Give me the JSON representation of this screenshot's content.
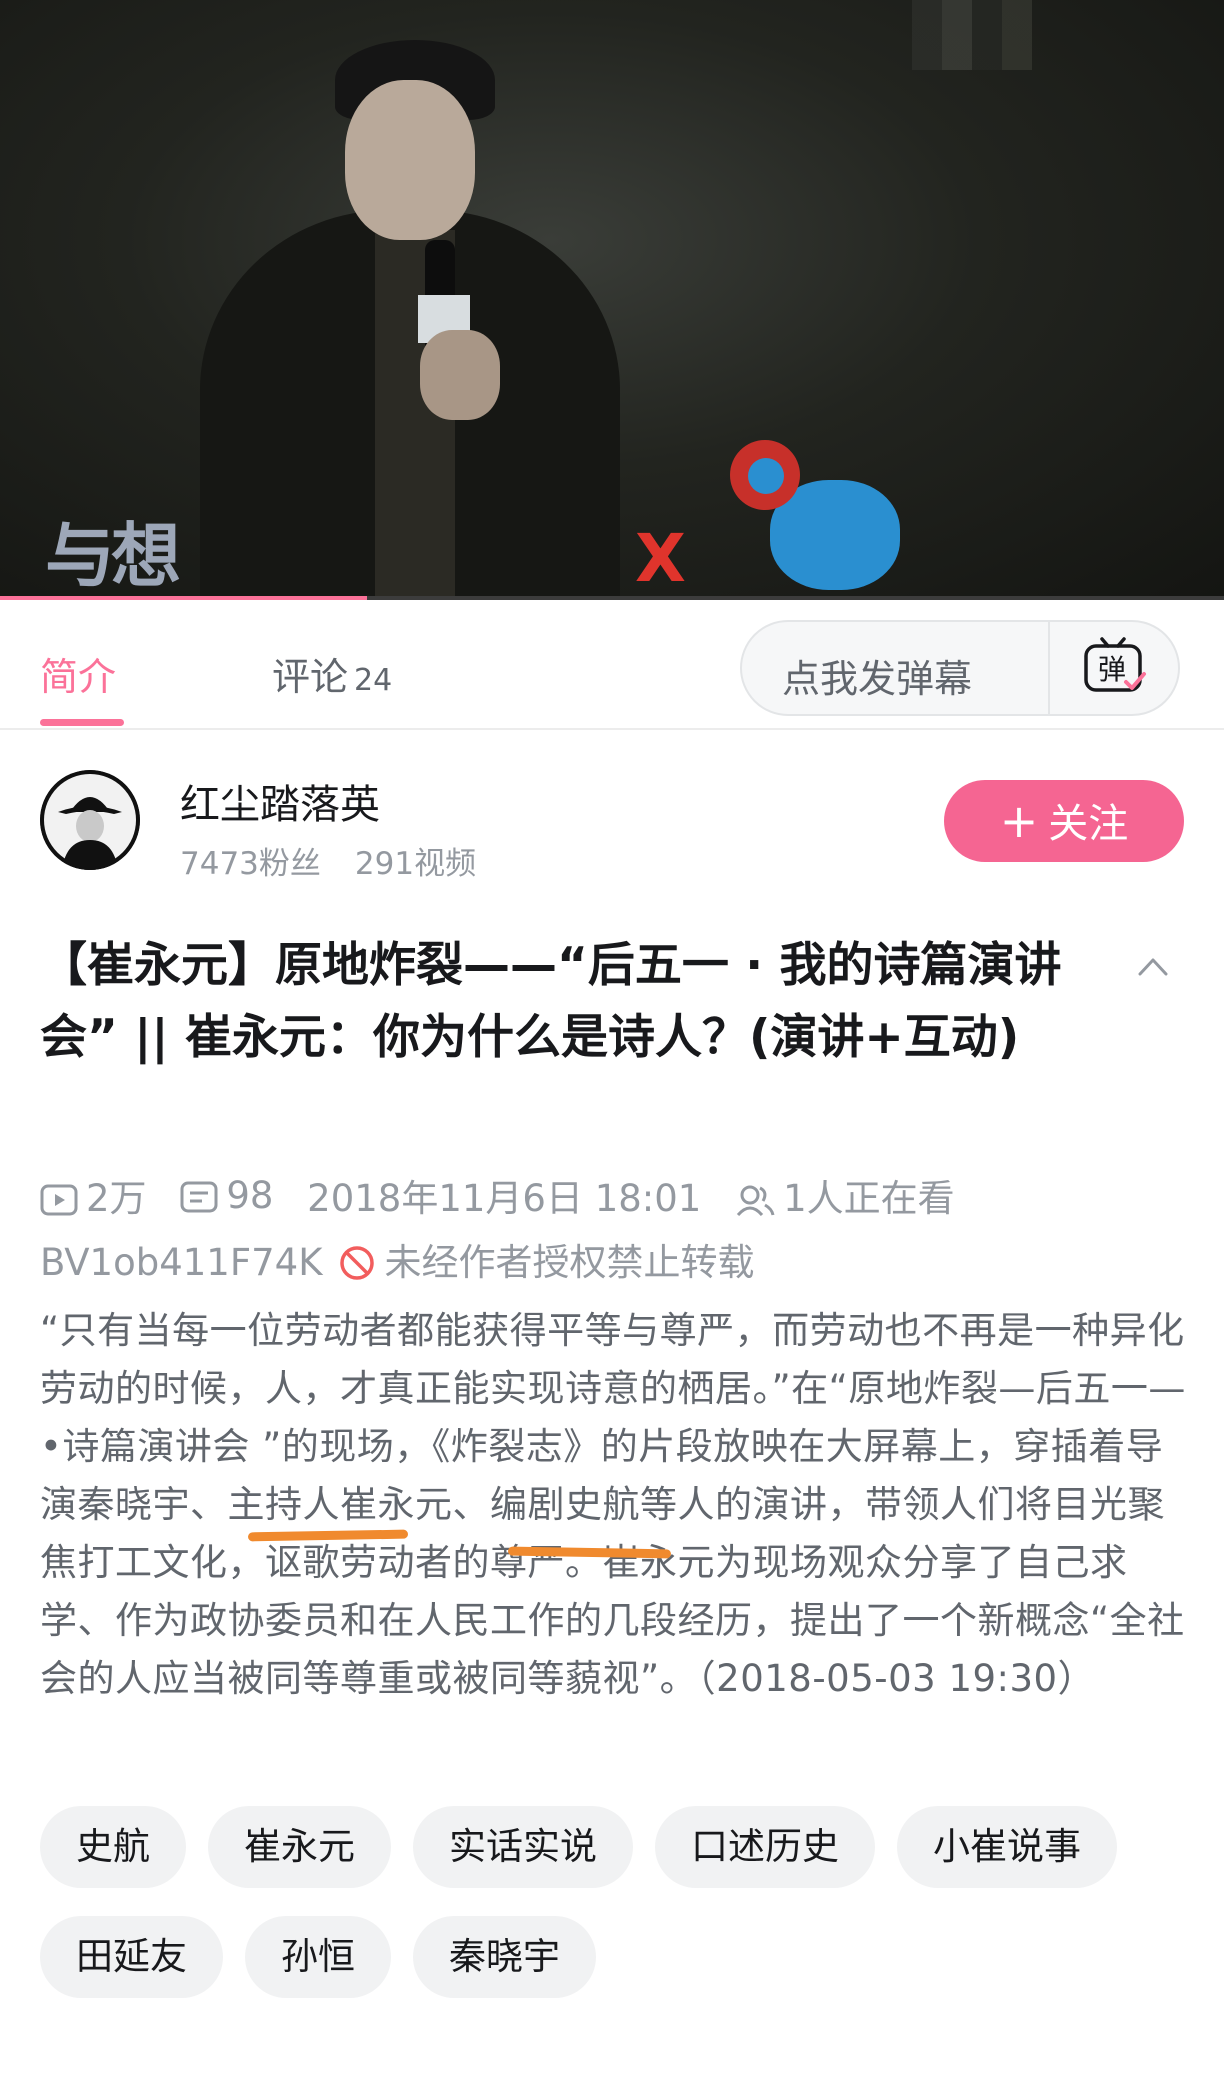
{
  "video": {
    "stage_text": "与想",
    "stage_x": "X",
    "progress": 0.3
  },
  "tabs": {
    "intro_label": "简介",
    "comments_label": "评论",
    "comments_count": "24",
    "danmaku_placeholder": "点我发弹幕",
    "danmaku_icon_text": "弹"
  },
  "uploader": {
    "name": "红尘踏落英",
    "fans": "7473粉丝",
    "videos": "291视频",
    "follow_label": "关注"
  },
  "video_info": {
    "title": "【崔永元】原地炸裂——“后五一 · 我的诗篇演讲会” || 崔永元：你为什么是诗人？(演讲+互动)",
    "views": "2万",
    "danmaku_count": "98",
    "publish_time": "2018年11月6日 18:01",
    "watching": "1人正在看",
    "bvid": "BV1ob411F74K",
    "copyright_notice": "未经作者授权禁止转载",
    "description": "“只有当每一位劳动者都能获得平等与尊严，而劳动也不再是一种异化劳动的时候，人，才真正能实现诗意的栖居。”在“原地炸裂—后五一—•诗篇演讲会 ”的现场，《炸裂志》的片段放映在大屏幕上，穿插着导演秦晓宇、主持人崔永元、编剧史航等人的演讲，带领人们将目光聚焦打工文化，讴歌劳动者的尊严。崔永元为现场观众分享了自己求学、作为政协委员和在人民工作的几段经历，提出了一个新概念“全社会的人应当被同等尊重或被同等藐视”。（2018-05-03 19:30）"
  },
  "tags": [
    "史航",
    "崔永元",
    "实话实说",
    "口述历史",
    "小崔说事",
    "田延友",
    "孙恒",
    "秦晓宇"
  ],
  "colors": {
    "accent": "#fb7299",
    "follow_button": "#f56592",
    "annotation_underline": "#f08a2e"
  }
}
